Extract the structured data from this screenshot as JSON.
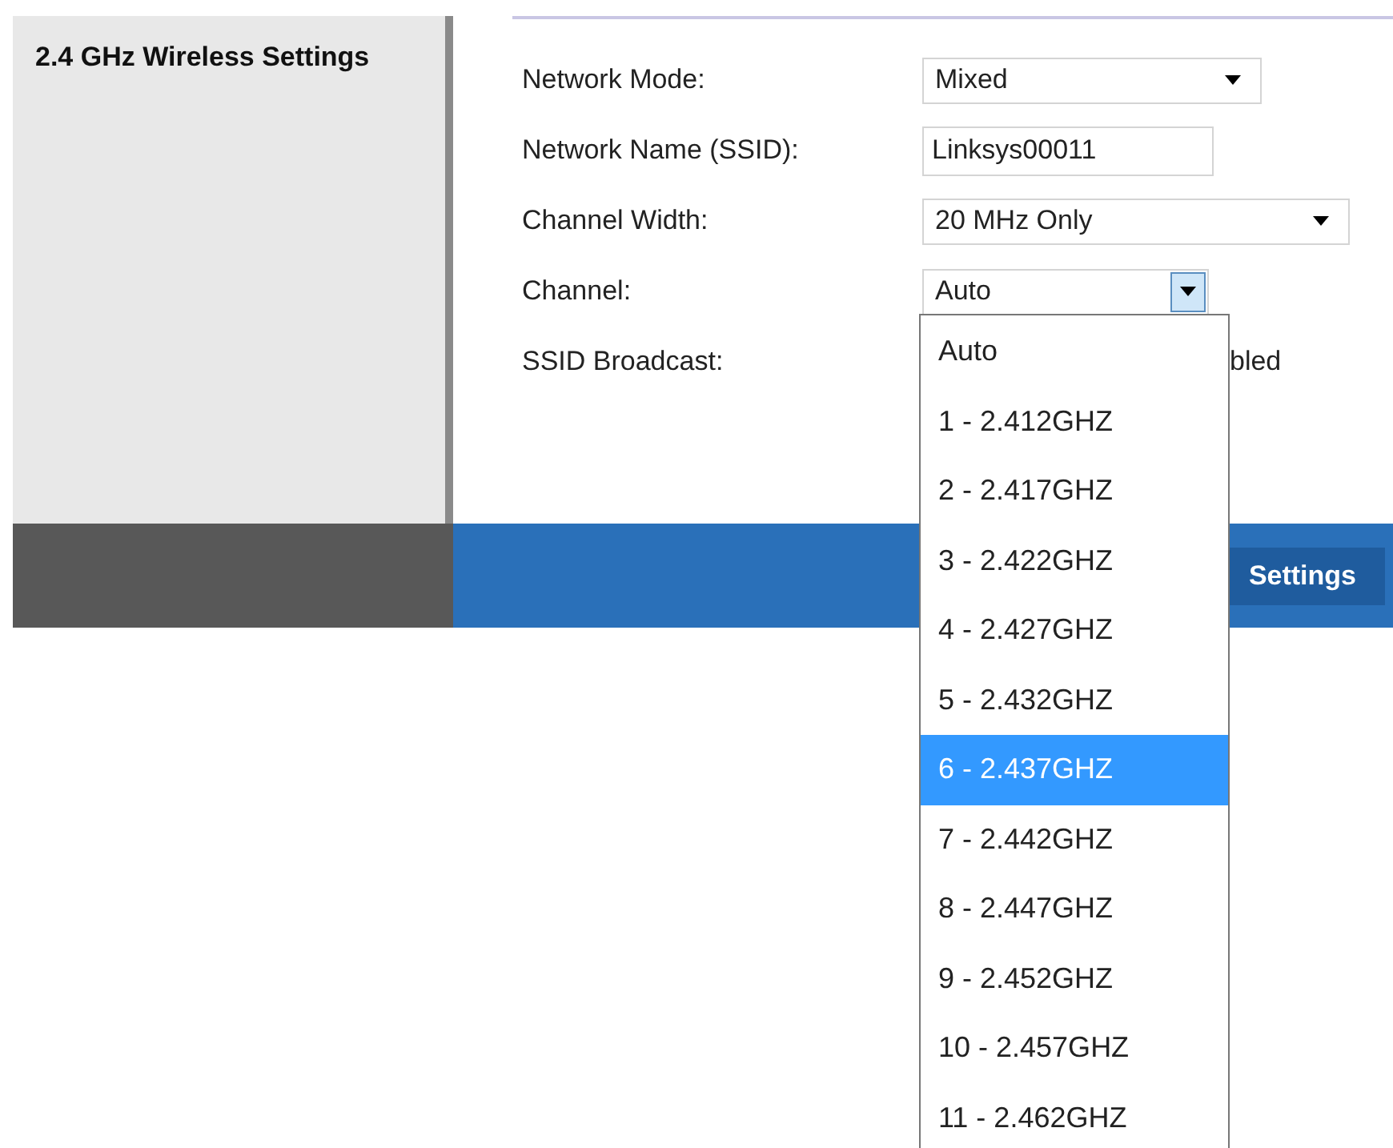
{
  "section_title": "2.4 GHz Wireless Settings",
  "fields": [
    {
      "kind": "select",
      "label": "Network Mode:",
      "value": "Mixed",
      "expanded": false
    },
    {
      "kind": "input",
      "label": "Network Name (SSID):",
      "value": "Linksys00011"
    },
    {
      "kind": "select",
      "label": "Channel Width:",
      "value": "20 MHz Only",
      "expanded": false
    },
    {
      "kind": "select",
      "label": "Channel:",
      "value": "Auto",
      "expanded": true
    },
    {
      "kind": "text",
      "label": "SSID Broadcast:",
      "value": "bled"
    }
  ],
  "dropdown_options": [
    {
      "label": "Auto",
      "selected": false
    },
    {
      "label": "1 - 2.412GHZ",
      "selected": false
    },
    {
      "label": "2 - 2.417GHZ",
      "selected": false
    },
    {
      "label": "3 - 2.422GHZ",
      "selected": false
    },
    {
      "label": "4 - 2.427GHZ",
      "selected": false
    },
    {
      "label": "5 - 2.432GHZ",
      "selected": false
    },
    {
      "label": "6 - 2.437GHZ",
      "selected": true
    },
    {
      "label": "7 - 2.442GHZ",
      "selected": false
    },
    {
      "label": "8 - 2.447GHZ",
      "selected": false
    },
    {
      "label": "9 - 2.452GHZ",
      "selected": false
    },
    {
      "label": "10 - 2.457GHZ",
      "selected": false
    },
    {
      "label": "11 - 2.462GHZ",
      "selected": false
    }
  ],
  "footer": {
    "button": "Settings"
  }
}
